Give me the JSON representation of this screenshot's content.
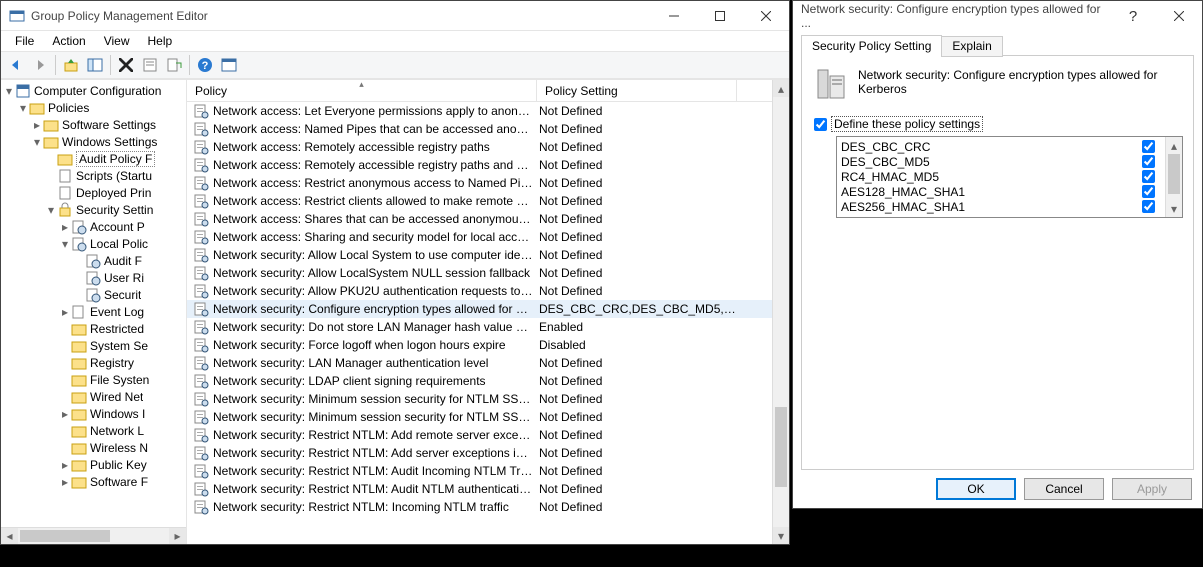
{
  "main": {
    "title": "Group Policy Management Editor",
    "menu": {
      "file": "File",
      "action": "Action",
      "view": "View",
      "help": "Help"
    },
    "columns": {
      "policy": "Policy",
      "setting": "Policy Setting"
    },
    "tree": {
      "root": "Computer Configuration",
      "n1": "Policies",
      "n2": "Software Settings",
      "n3": "Windows Settings",
      "n4": "Audit Policy F",
      "n5": "Scripts (Startu",
      "n6": "Deployed Prin",
      "n7": "Security Settin",
      "n8": "Account P",
      "n9": "Local Polic",
      "n10": "Audit F",
      "n11": "User Ri",
      "n12": "Securit",
      "n13": "Event Log",
      "n14": "Restricted",
      "n15": "System Se",
      "n16": "Registry",
      "n17": "File Systen",
      "n18": "Wired Net",
      "n19": "Windows I",
      "n20": "Network L",
      "n21": "Wireless N",
      "n22": "Public Key",
      "n23": "Software F"
    },
    "rows": [
      {
        "p": "Network access: Let Everyone permissions apply to anonym...",
        "s": "Not Defined"
      },
      {
        "p": "Network access: Named Pipes that can be accessed anonym...",
        "s": "Not Defined"
      },
      {
        "p": "Network access: Remotely accessible registry paths",
        "s": "Not Defined"
      },
      {
        "p": "Network access: Remotely accessible registry paths and sub...",
        "s": "Not Defined"
      },
      {
        "p": "Network access: Restrict anonymous access to Named Pipes...",
        "s": "Not Defined"
      },
      {
        "p": "Network access: Restrict clients allowed to make remote call...",
        "s": "Not Defined"
      },
      {
        "p": "Network access: Shares that can be accessed anonymously",
        "s": "Not Defined"
      },
      {
        "p": "Network access: Sharing and security model for local accou...",
        "s": "Not Defined"
      },
      {
        "p": "Network security: Allow Local System to use computer ident...",
        "s": "Not Defined"
      },
      {
        "p": "Network security: Allow LocalSystem NULL session fallback",
        "s": "Not Defined"
      },
      {
        "p": "Network security: Allow PKU2U authentication requests to t...",
        "s": "Not Defined"
      },
      {
        "p": "Network security: Configure encryption types allowed for Ke...",
        "s": "DES_CBC_CRC,DES_CBC_MD5,R...",
        "sel": true
      },
      {
        "p": "Network security: Do not store LAN Manager hash value on ...",
        "s": "Enabled"
      },
      {
        "p": "Network security: Force logoff when logon hours expire",
        "s": "Disabled"
      },
      {
        "p": "Network security: LAN Manager authentication level",
        "s": "Not Defined"
      },
      {
        "p": "Network security: LDAP client signing requirements",
        "s": "Not Defined"
      },
      {
        "p": "Network security: Minimum session security for NTLM SSP ...",
        "s": "Not Defined"
      },
      {
        "p": "Network security: Minimum session security for NTLM SSP ...",
        "s": "Not Defined"
      },
      {
        "p": "Network security: Restrict NTLM: Add remote server excepti...",
        "s": "Not Defined"
      },
      {
        "p": "Network security: Restrict NTLM: Add server exceptions in t...",
        "s": "Not Defined"
      },
      {
        "p": "Network security: Restrict NTLM: Audit Incoming NTLM Tra...",
        "s": "Not Defined"
      },
      {
        "p": "Network security: Restrict NTLM: Audit NTLM authenticatio...",
        "s": "Not Defined"
      },
      {
        "p": "Network security: Restrict NTLM: Incoming NTLM traffic",
        "s": "Not Defined"
      }
    ]
  },
  "dialog": {
    "title": "Network security: Configure encryption types allowed for ...",
    "tabs": {
      "t1": "Security Policy Setting",
      "t2": "Explain"
    },
    "heading": "Network security: Configure encryption types allowed for Kerberos",
    "define": "Define these policy settings",
    "options": [
      "DES_CBC_CRC",
      "DES_CBC_MD5",
      "RC4_HMAC_MD5",
      "AES128_HMAC_SHA1",
      "AES256_HMAC_SHA1"
    ],
    "buttons": {
      "ok": "OK",
      "cancel": "Cancel",
      "apply": "Apply"
    }
  }
}
